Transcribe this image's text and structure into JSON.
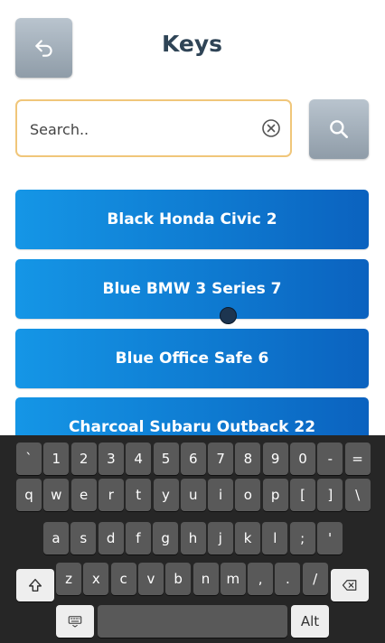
{
  "header": {
    "title": "Keys",
    "back_icon": "undo-arrow-icon"
  },
  "search": {
    "placeholder": "Search..",
    "value": "",
    "clear_icon": "clear-circle-x-icon",
    "button_icon": "magnifier-icon"
  },
  "keys_list": [
    {
      "label": "Black Honda Civic 2"
    },
    {
      "label": "Blue BMW 3 Series 7"
    },
    {
      "label": "Blue Office Safe 6"
    },
    {
      "label": "Charcoal Subaru Outback 22"
    }
  ],
  "keyboard": {
    "row1": [
      "`",
      "1",
      "2",
      "3",
      "4",
      "5",
      "6",
      "7",
      "8",
      "9",
      "0",
      "-",
      "="
    ],
    "row2": [
      "q",
      "w",
      "e",
      "r",
      "t",
      "y",
      "u",
      "i",
      "o",
      "p",
      "[",
      "]",
      "\\"
    ],
    "row3": [
      "a",
      "s",
      "d",
      "f",
      "g",
      "h",
      "j",
      "k",
      "l",
      ";",
      "'"
    ],
    "row4": [
      "z",
      "x",
      "c",
      "v",
      "b",
      "n",
      "m",
      ",",
      ".",
      "/"
    ],
    "shift_icon": "shift-arrow-icon",
    "backspace_icon": "backspace-icon",
    "hide_keyboard_icon": "keyboard-hide-icon",
    "alt_label": "Alt"
  },
  "colors": {
    "title": "#2f4456",
    "list_button": "#0e78cf",
    "search_border": "#f0c67a",
    "keyboard_bg": "#262626",
    "key_bg": "#595959"
  }
}
